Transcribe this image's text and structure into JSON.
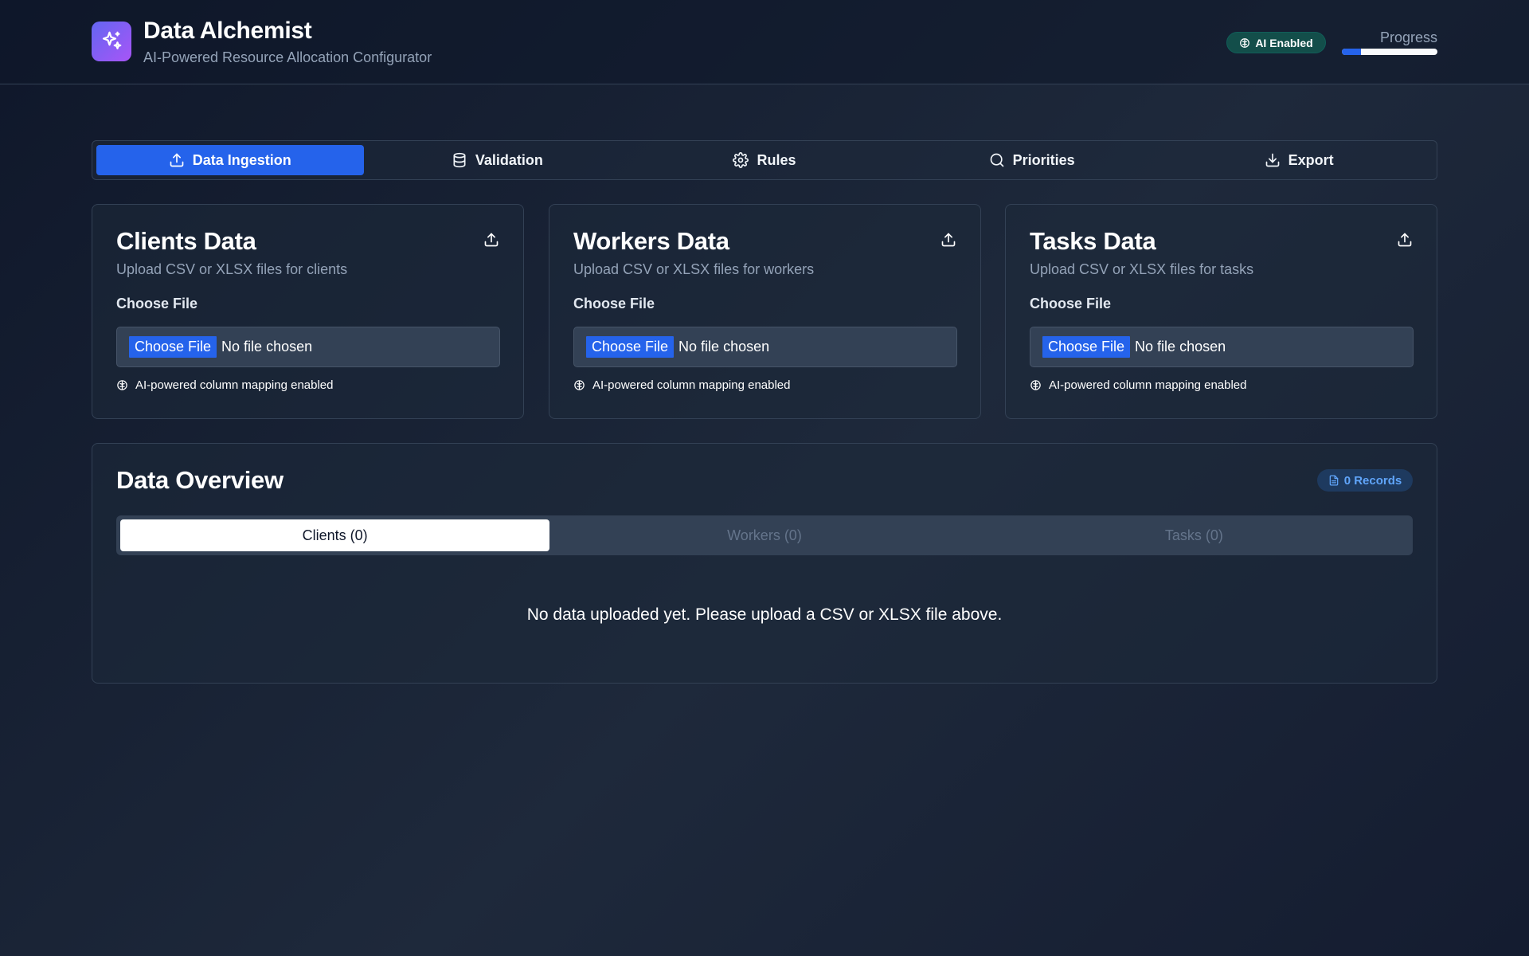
{
  "header": {
    "title": "Data Alchemist",
    "subtitle": "AI-Powered Resource Allocation Configurator",
    "ai_badge": "AI Enabled",
    "progress_label": "Progress",
    "progress_fraction": 0.2,
    "logo_icon": "sparkles-icon"
  },
  "tabs": [
    {
      "label": "Data Ingestion",
      "icon": "upload-icon",
      "active": true
    },
    {
      "label": "Validation",
      "icon": "database-icon",
      "active": false
    },
    {
      "label": "Rules",
      "icon": "gear-icon",
      "active": false
    },
    {
      "label": "Priorities",
      "icon": "search-icon",
      "active": false
    },
    {
      "label": "Export",
      "icon": "download-icon",
      "active": false
    }
  ],
  "upload_cards": [
    {
      "title": "Clients Data",
      "description": "Upload CSV or XLSX files for clients",
      "file_label": "Choose File",
      "button": "Choose File",
      "status": "No file chosen",
      "note": "AI-powered column mapping enabled"
    },
    {
      "title": "Workers Data",
      "description": "Upload CSV or XLSX files for workers",
      "file_label": "Choose File",
      "button": "Choose File",
      "status": "No file chosen",
      "note": "AI-powered column mapping enabled"
    },
    {
      "title": "Tasks Data",
      "description": "Upload CSV or XLSX files for tasks",
      "file_label": "Choose File",
      "button": "Choose File",
      "status": "No file chosen",
      "note": "AI-powered column mapping enabled"
    }
  ],
  "overview": {
    "title": "Data Overview",
    "records_badge": "0 Records",
    "tabs": [
      {
        "label": "Clients (0)",
        "active": true
      },
      {
        "label": "Workers (0)",
        "active": false
      },
      {
        "label": "Tasks (0)",
        "active": false
      }
    ],
    "empty_message": "No data uploaded yet. Please upload a CSV or XLSX file above."
  },
  "colors": {
    "accent": "#2563eb",
    "background": "#0f172a",
    "ai_badge_bg": "#134e4a",
    "records_text": "#60a5fa"
  }
}
